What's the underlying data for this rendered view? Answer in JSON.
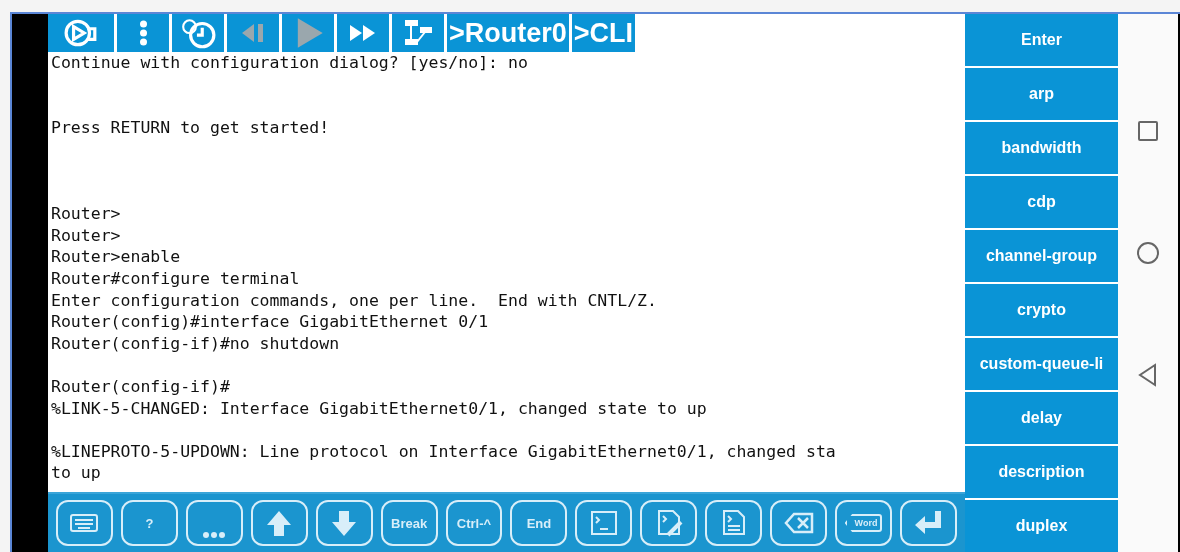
{
  "toolbar": [
    {
      "kind": "zoom",
      "disabled": false
    },
    {
      "kind": "menu",
      "disabled": false
    },
    {
      "kind": "timer",
      "disabled": false
    },
    {
      "kind": "back",
      "disabled": true
    },
    {
      "kind": "play",
      "disabled": true
    },
    {
      "kind": "forward",
      "disabled": false
    },
    {
      "kind": "topology",
      "disabled": false
    },
    {
      "kind": "text",
      "label": ">Router0",
      "disabled": false
    },
    {
      "kind": "text",
      "label": ">CLI",
      "disabled": false
    }
  ],
  "terminal": {
    "blocks": [
      {
        "kind": "top",
        "lines": [
          "Continue with configuration dialog? [yes/no]: no"
        ]
      },
      {
        "kind": "double",
        "lines": [
          "Press RETURN to get started!"
        ]
      },
      {
        "kind": "triple",
        "lines": [
          "Router>",
          "Router>",
          "Router>enable",
          "Router#configure terminal",
          "Enter configuration commands, one per line.  End with CNTL/Z.",
          "Router(config)#interface GigabitEthernet 0/1",
          "Router(config-if)#no shutdown"
        ]
      },
      {
        "kind": "single",
        "lines": [
          "Router(config-if)#",
          "%LINK-5-CHANGED: Interface GigabitEthernet0/1, changed state to up"
        ]
      },
      {
        "kind": "single",
        "lines": [
          "%LINEPROTO-5-UPDOWN: Line protocol on Interface GigabitEthernet0/1, changed sta",
          "to up"
        ]
      }
    ]
  },
  "commands": [
    "Enter",
    "arp",
    "bandwidth",
    "cdp",
    "channel-group",
    "crypto",
    "custom-queue-li",
    "delay",
    "description",
    "duplex"
  ],
  "keys": [
    {
      "kind": "keyboard"
    },
    {
      "kind": "text",
      "label": "?"
    },
    {
      "kind": "dots"
    },
    {
      "kind": "up"
    },
    {
      "kind": "down"
    },
    {
      "kind": "text",
      "label": "Break"
    },
    {
      "kind": "text",
      "label": "Ctrl-^"
    },
    {
      "kind": "text",
      "label": "End"
    },
    {
      "kind": "terminal"
    },
    {
      "kind": "edit"
    },
    {
      "kind": "document"
    },
    {
      "kind": "backspace"
    },
    {
      "kind": "word",
      "label": "Word"
    },
    {
      "kind": "enter"
    }
  ]
}
